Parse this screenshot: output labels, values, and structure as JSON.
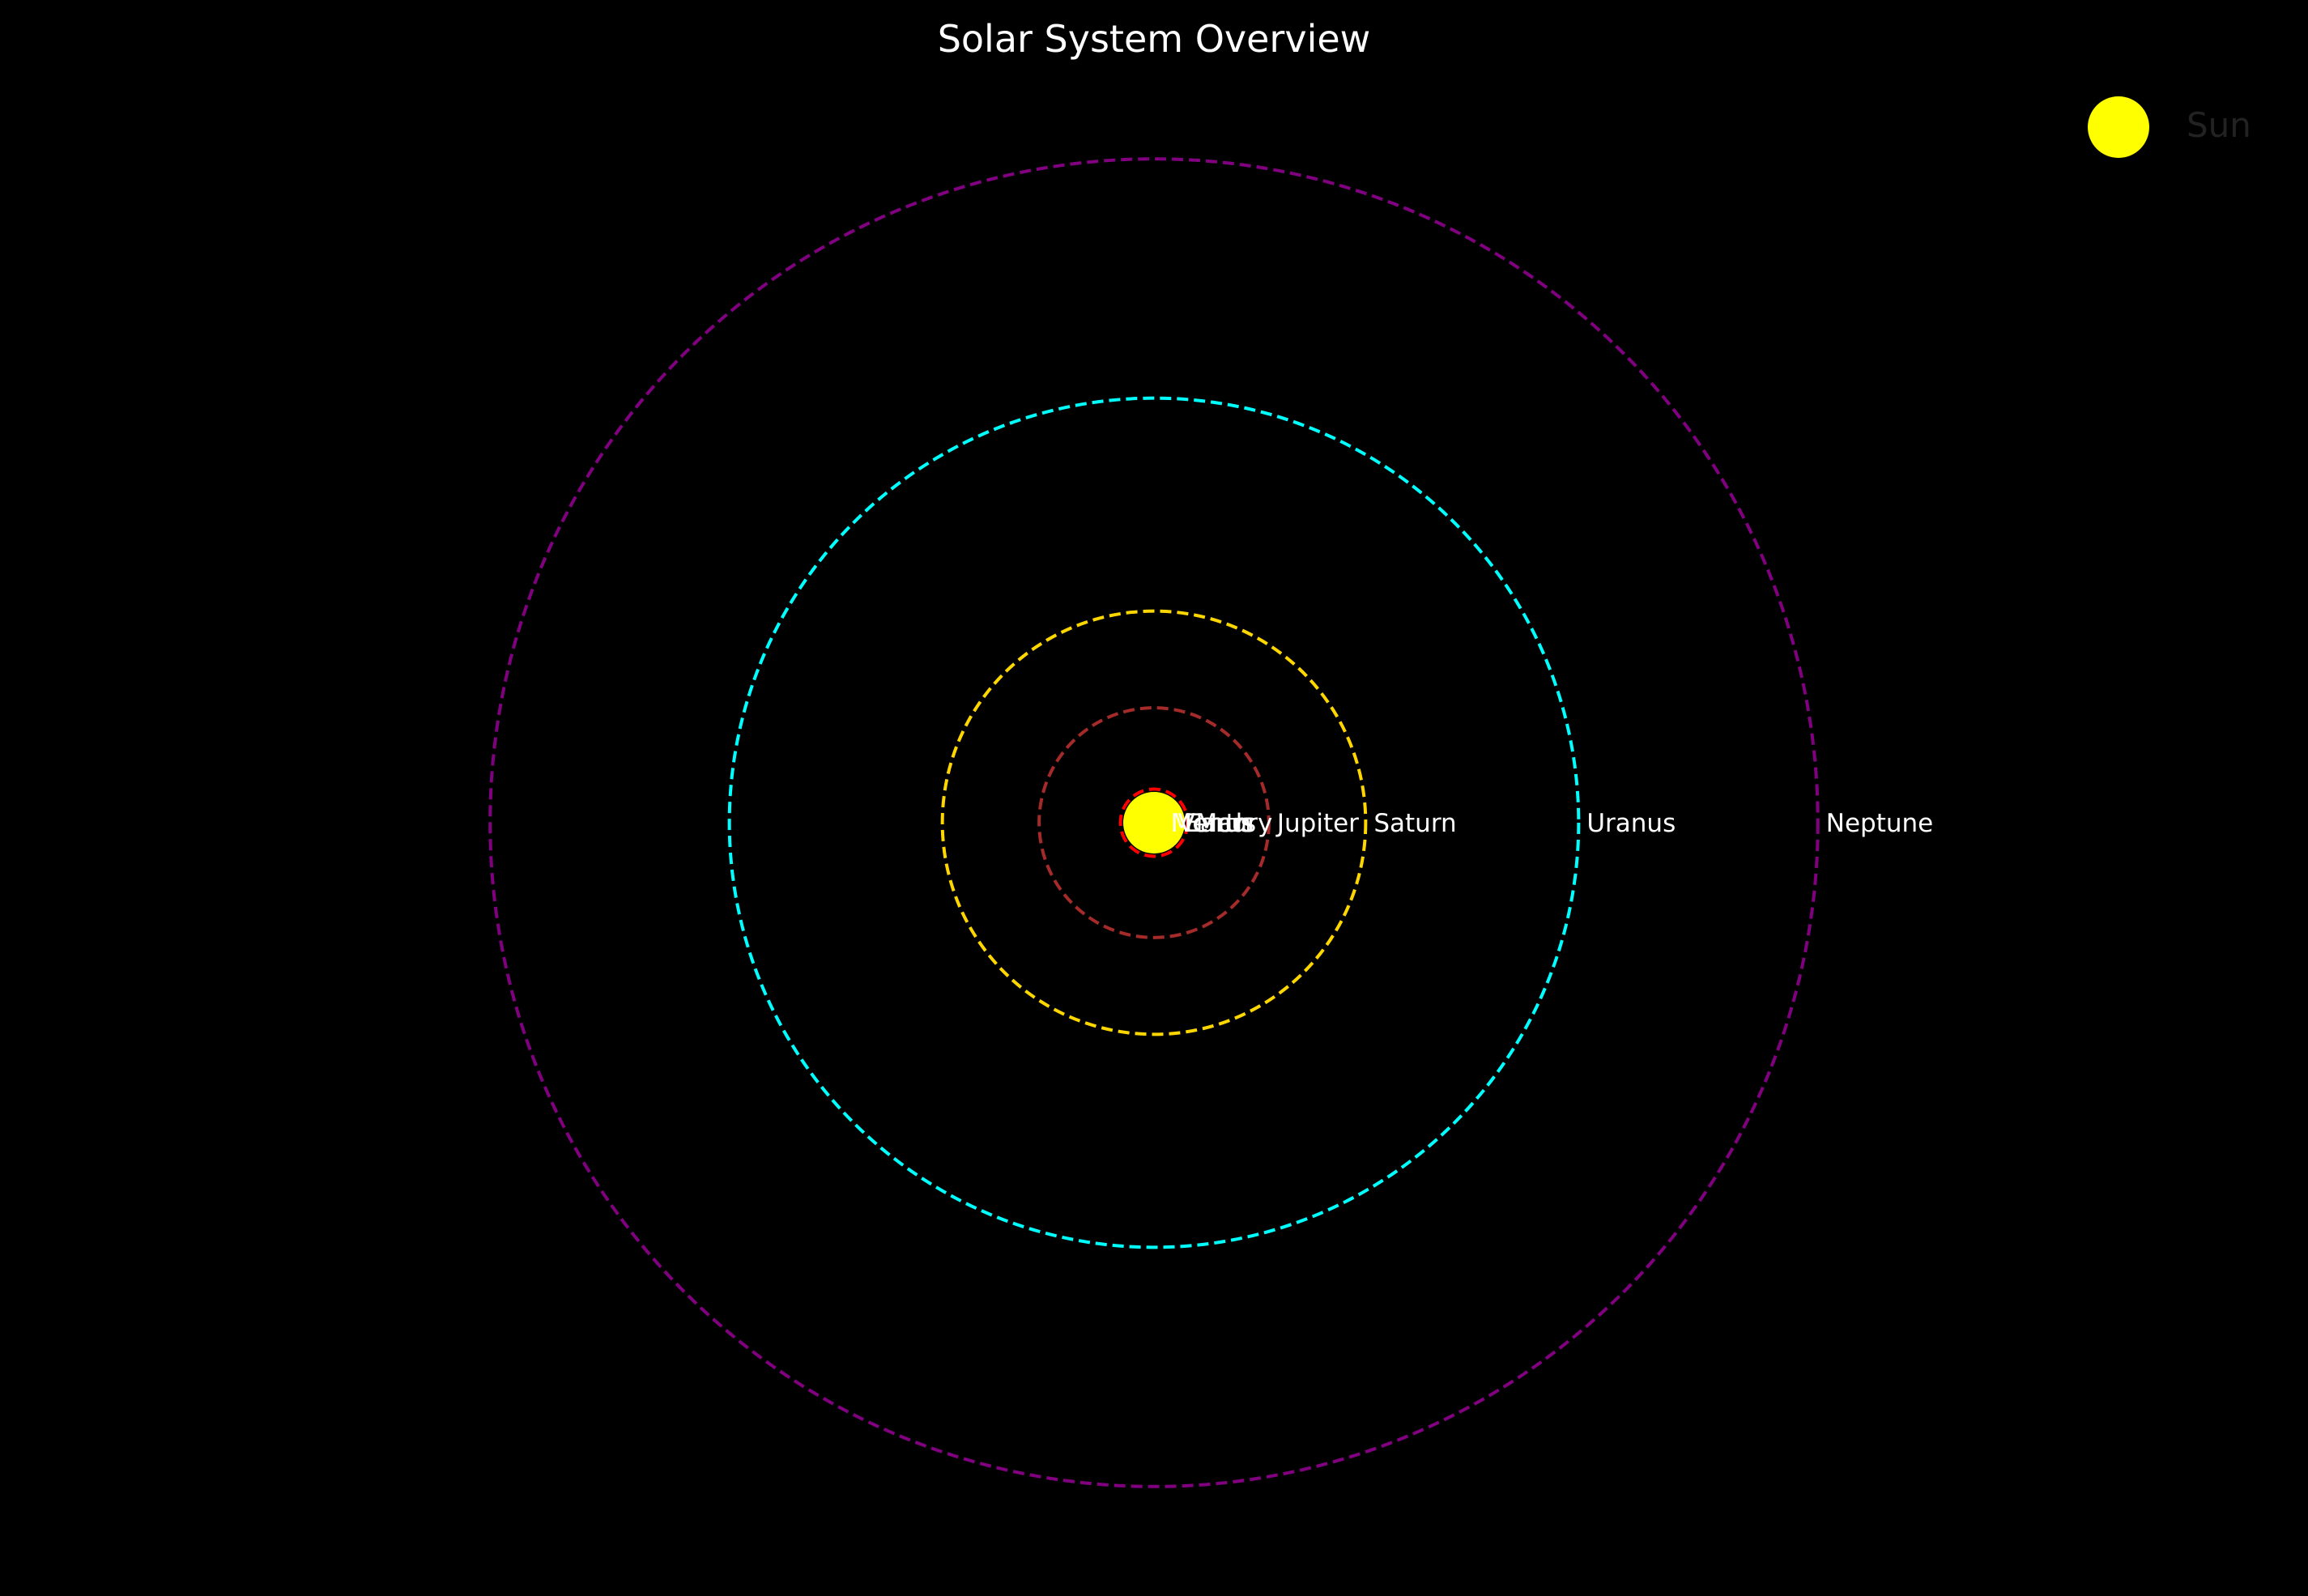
{
  "chart_data": {
    "type": "scatter",
    "title": "Solar System Overview",
    "xlabel": "",
    "ylabel": "",
    "grid": false,
    "axes_visible": false,
    "legend_position": "top-right",
    "background": "#000000",
    "units": "AU",
    "x_range": [
      -32,
      32
    ],
    "legend": [
      {
        "label": "Sun",
        "color": "#ffff00"
      }
    ],
    "center": {
      "name": "Sun",
      "color": "#ffff00"
    },
    "planets": [
      {
        "name": "Mercury",
        "distance": 0.39,
        "orbit_color": "#808080"
      },
      {
        "name": "Venus",
        "distance": 0.72,
        "orbit_color": "#ffa500"
      },
      {
        "name": "Earth",
        "distance": 1.0,
        "orbit_color": "#0000ff"
      },
      {
        "name": "Mars",
        "distance": 1.52,
        "orbit_color": "#ff0000"
      },
      {
        "name": "Jupiter",
        "distance": 5.2,
        "orbit_color": "#a52a2a"
      },
      {
        "name": "Saturn",
        "distance": 9.58,
        "orbit_color": "#ffd700"
      },
      {
        "name": "Uranus",
        "distance": 19.22,
        "orbit_color": "#00ffff"
      },
      {
        "name": "Neptune",
        "distance": 30.05,
        "orbit_color": "#800080"
      }
    ]
  }
}
